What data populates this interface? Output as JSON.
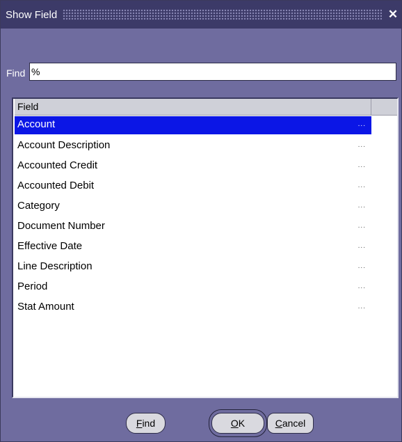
{
  "window": {
    "title": "Show Field",
    "close_glyph": "✕"
  },
  "find": {
    "label": "Find",
    "value": "%"
  },
  "list": {
    "header": "Field",
    "selected_index": 0,
    "ellipsis": "...",
    "items": [
      "Account",
      "Account Description",
      "Accounted Credit",
      "Accounted Debit",
      "Category",
      "Document Number",
      "Effective Date",
      "Line Description",
      "Period",
      "Stat Amount"
    ]
  },
  "buttons": {
    "find": {
      "mnemonic": "F",
      "rest": "ind"
    },
    "ok": {
      "mnemonic": "O",
      "rest": "K"
    },
    "cancel": {
      "mnemonic": "C",
      "rest": "ancel"
    }
  }
}
